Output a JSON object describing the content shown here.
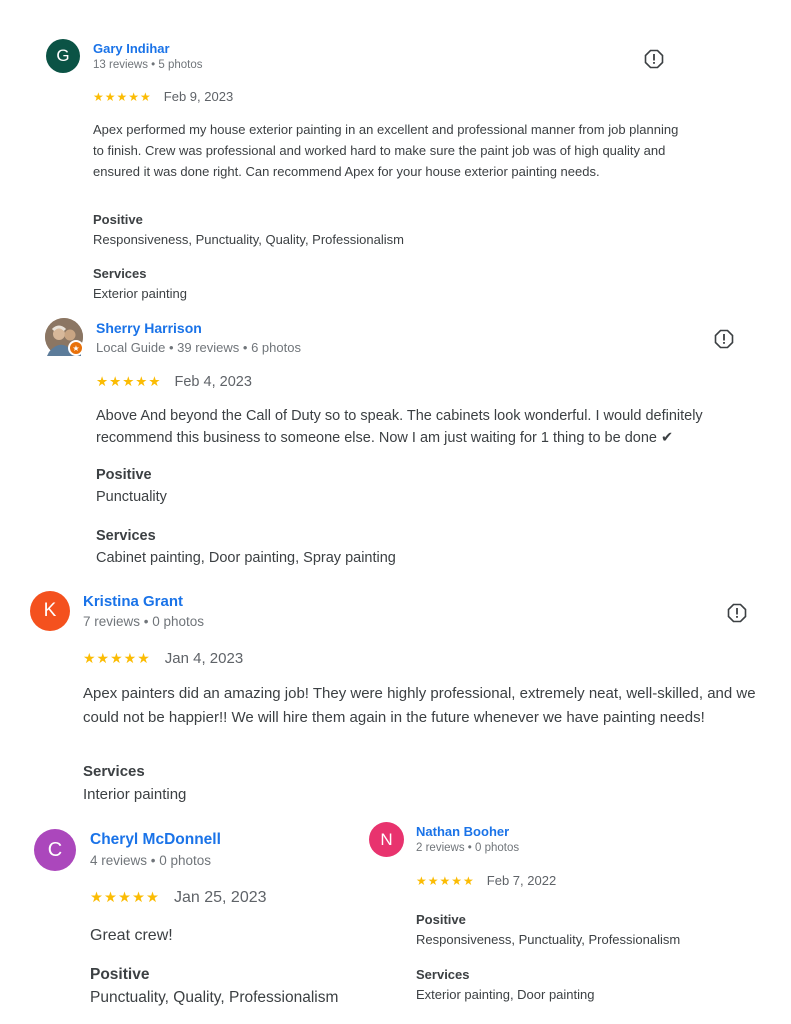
{
  "reviews": [
    {
      "initial": "G",
      "name": "Gary Indihar",
      "meta": "13 reviews • 5 photos",
      "stars": "★★★★★",
      "rating_value": 5,
      "date": "Feb 9, 2023",
      "text": "Apex performed my house exterior painting in an excellent and professional manner from job planning to finish. Crew was professional and worked hard to make sure the paint job was of high quality and ensured it was done right. Can recommend Apex for your house exterior painting needs.",
      "positive_label": "Positive",
      "positive": "Responsiveness, Punctuality, Quality, Professionalism",
      "services_label": "Services",
      "services": "Exterior painting",
      "avatar_color": "#0b5345"
    },
    {
      "initial": "",
      "name": "Sherry Harrison",
      "meta": "Local Guide • 39 reviews • 6 photos",
      "stars": "★★★★★",
      "rating_value": 5,
      "date": "Feb 4, 2023",
      "text": "Above And beyond the Call of Duty so to speak. The cabinets look wonderful. I would definitely recommend this business to someone else. Now I am just waiting for 1 thing to be done ✔",
      "positive_label": "Positive",
      "positive": "Punctuality",
      "services_label": "Services",
      "services": "Cabinet painting, Door painting, Spray painting",
      "badge_icon": "★"
    },
    {
      "initial": "K",
      "name": "Kristina Grant",
      "meta": "7 reviews • 0 photos",
      "stars": "★★★★★",
      "rating_value": 5,
      "date": "Jan 4, 2023",
      "text": "Apex painters did an amazing job! They were highly professional, extremely neat, well-skilled, and we could not be happier!! We will hire them again in the future whenever we have painting needs!",
      "services_label": "Services",
      "services": "Interior painting",
      "avatar_color": "#f4511e"
    },
    {
      "initial": "C",
      "name": "Cheryl McDonnell",
      "meta": "4 reviews • 0 photos",
      "stars": "★★★★★",
      "rating_value": 5,
      "date": "Jan 25, 2023",
      "text": "Great crew!",
      "positive_label": "Positive",
      "positive": "Punctuality, Quality, Professionalism",
      "avatar_color": "#ab47bc"
    },
    {
      "initial": "N",
      "name": "Nathan Booher",
      "meta": "2 reviews • 0 photos",
      "stars": "★★★★★",
      "rating_value": 5,
      "date": "Feb 7, 2022",
      "positive_label": "Positive",
      "positive": "Responsiveness, Punctuality, Professionalism",
      "services_label": "Services",
      "services": "Exterior painting, Door painting",
      "avatar_color": "#e8336e"
    }
  ],
  "colors": {
    "name_link": "#1a73e8",
    "star": "#fbbc04",
    "meta": "#70757a",
    "text": "#3c4043"
  },
  "icons": {
    "flag": "report-flag-icon",
    "star": "star-icon"
  }
}
